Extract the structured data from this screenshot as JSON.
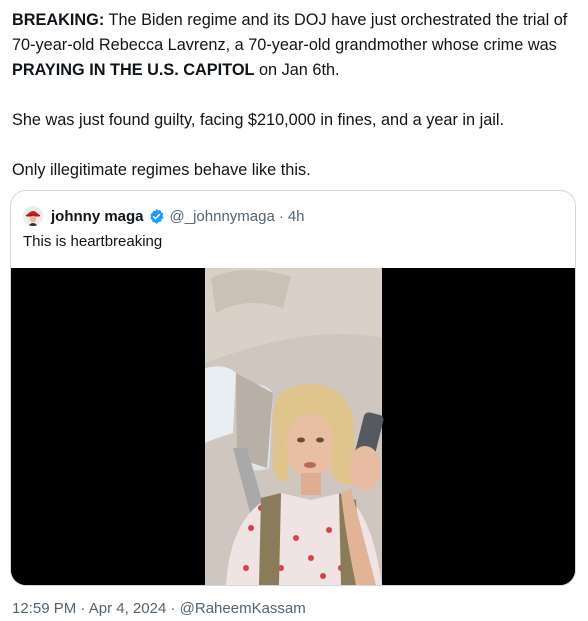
{
  "tweet": {
    "line1_bold": "BREAKING:",
    "line1_rest": " The Biden regime and its DOJ have just orchestrated the trial of 70-year-old Rebecca Lavrenz, a 70-year-old grandmother whose crime was ",
    "line1_bold2": "PRAYING IN THE U.S. CAPITOL",
    "line1_end": " on Jan 6th.",
    "paragraph2": "She was just found guilty, facing $210,000 in fines, and a year in jail.",
    "paragraph3": "Only illegitimate regimes behave like this."
  },
  "quoted_tweet": {
    "display_name": "johnny maga",
    "handle": "@_johnnymaga",
    "separator": "·",
    "time": "4h",
    "text": "This is heartbreaking",
    "verified_color": "#1d9bf0",
    "avatar_icon": "maga-hat-avatar-icon",
    "video_thumbnail": "woman-in-car-video"
  },
  "footer": {
    "time": "12:59 PM",
    "sep1": " · ",
    "date": "Apr 4, 2024",
    "sep2": " · ",
    "author": "@RaheemKassam"
  },
  "colors": {
    "text": "#0f1419",
    "muted": "#536471",
    "border": "#cfd9de",
    "verified": "#1d9bf0"
  }
}
